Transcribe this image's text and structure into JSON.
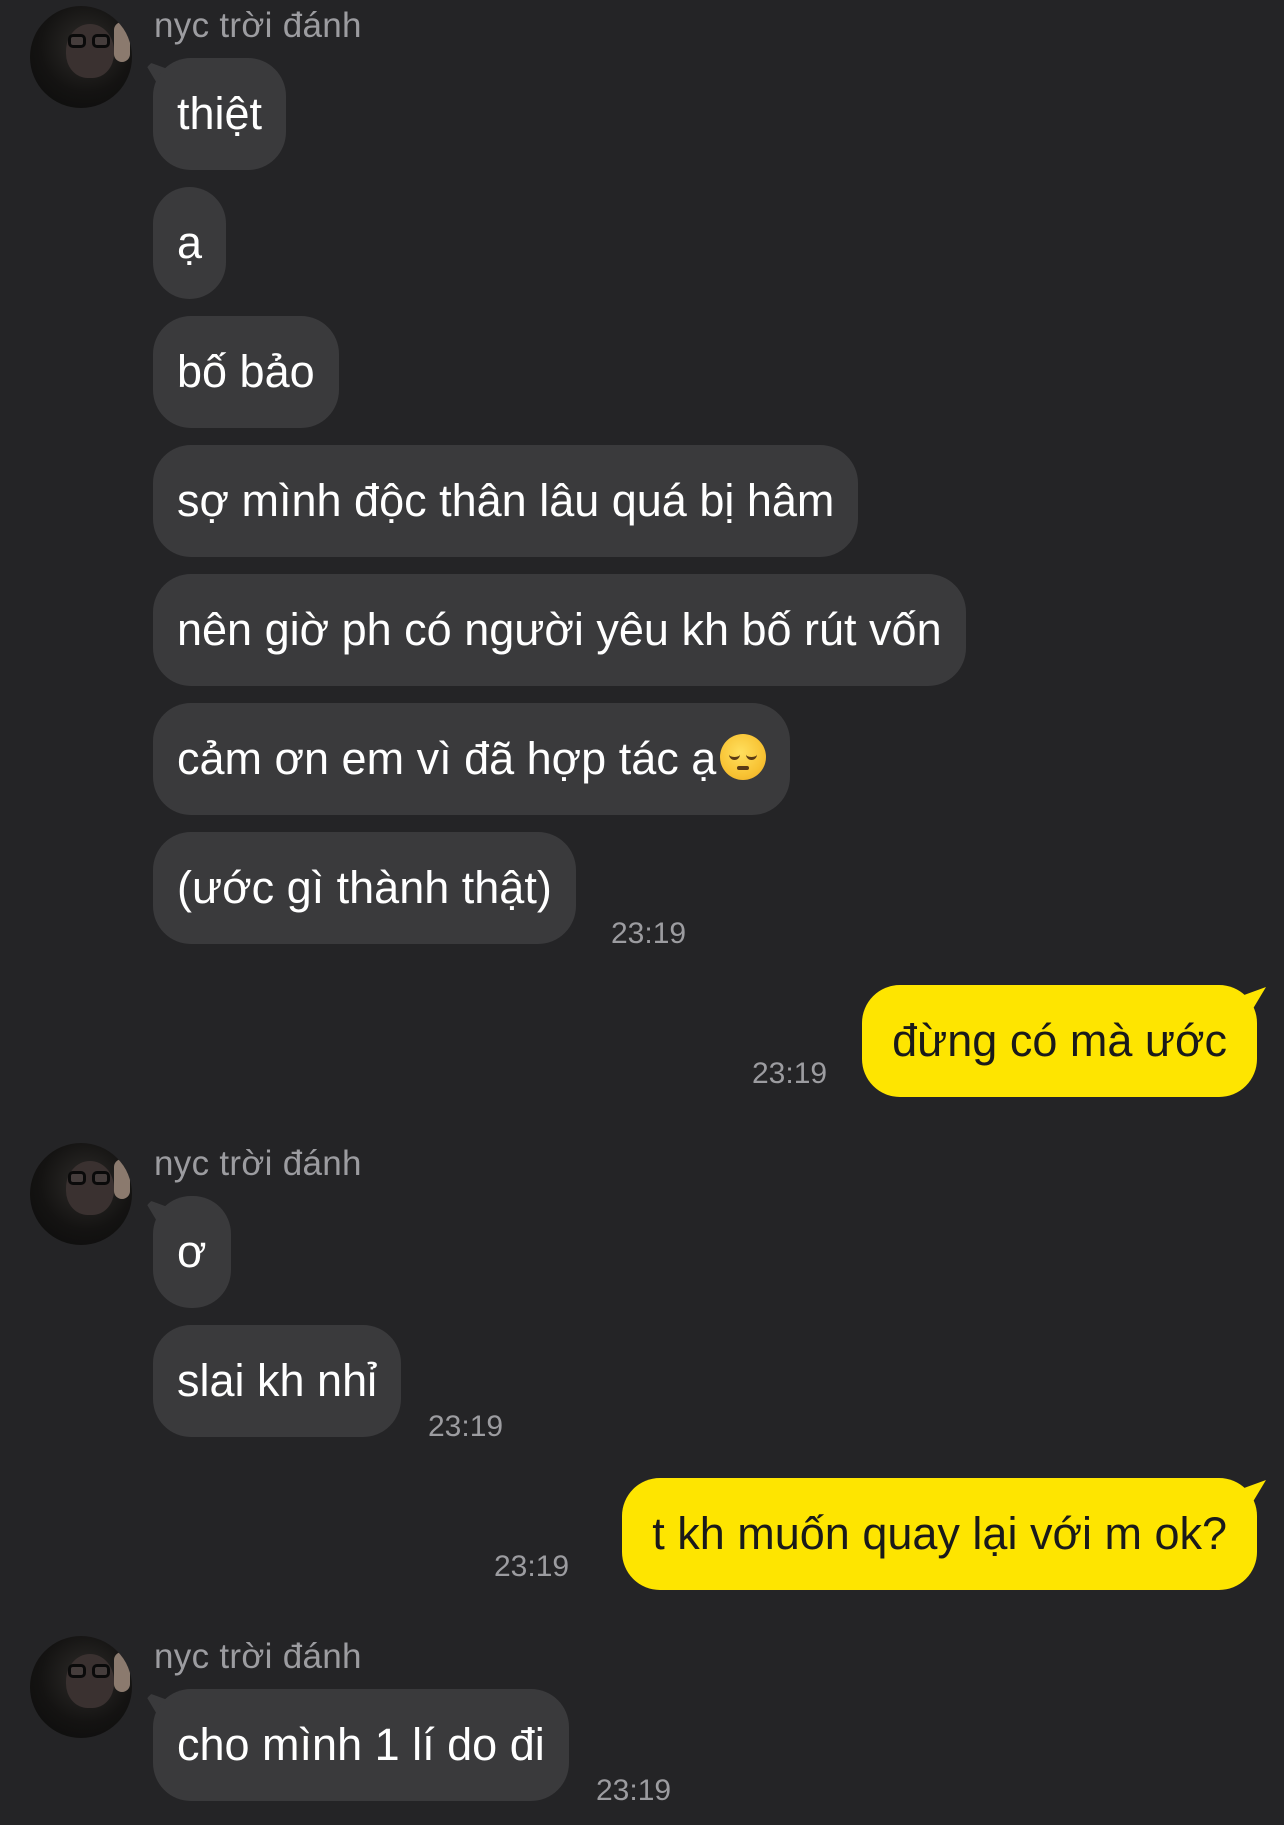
{
  "colors": {
    "background": "#242426",
    "incoming_bubble": "#3a3a3c",
    "outgoing_bubble": "#fee500",
    "meta_text": "#9c9ca0"
  },
  "chat": {
    "contact_name": "nyc trời đánh",
    "groups": [
      {
        "sender": "nyc trời đánh",
        "messages": [
          "thiệt",
          "ạ",
          "bố bảo",
          "sợ mình độc thân lâu quá bị hâm",
          "nên giờ ph có người yêu kh bố rút vốn",
          "cảm ơn em vì đã hợp tác ạ",
          "(ước gì thành thật)"
        ],
        "emoji": "pensive-face-emoji",
        "time": "23:19"
      },
      {
        "sender": "me",
        "messages": [
          "đừng có mà ước"
        ],
        "time": "23:19"
      },
      {
        "sender": "nyc trời đánh",
        "messages": [
          "ơ",
          "slai kh nhỉ"
        ],
        "time": "23:19"
      },
      {
        "sender": "me",
        "messages": [
          "t kh muốn quay lại với m ok?"
        ],
        "time": "23:19"
      },
      {
        "sender": "nyc trời đánh",
        "messages": [
          "cho mình 1 lí do đi"
        ],
        "time": "23:19"
      }
    ]
  }
}
